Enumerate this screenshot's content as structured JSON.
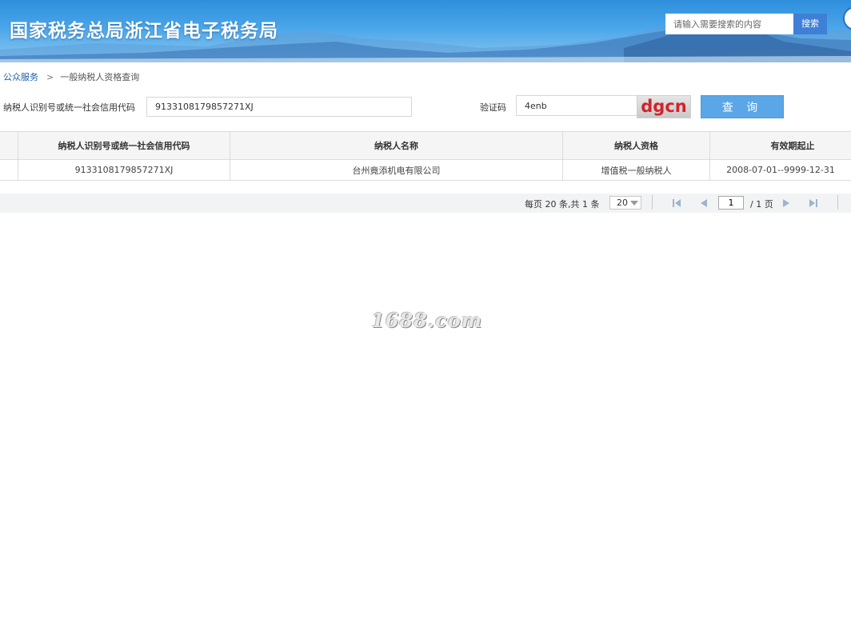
{
  "header": {
    "site_title": "国家税务总局浙江省电子税务局",
    "search_placeholder": "请输入需要搜索的内容",
    "search_button": "搜索"
  },
  "breadcrumb": {
    "root": "公众服务",
    "separator": ">",
    "current": "一般纳税人资格查询"
  },
  "form": {
    "taxpayer_id_label": "纳税人识别号或统一社会信用代码",
    "taxpayer_id_value": "9133108179857271XJ",
    "captcha_label": "验证码",
    "captcha_value": "4enb",
    "captcha_image_text": "dgcn",
    "query_button": "查 询"
  },
  "table": {
    "columns": [
      "纳税人识别号或统一社会信用代码",
      "纳税人名称",
      "纳税人资格",
      "有效期起止"
    ],
    "rows": [
      [
        "9133108179857271XJ",
        "台州竟添机电有限公司",
        "增值税一般纳税人",
        "2008-07-01--9999-12-31"
      ]
    ]
  },
  "pager": {
    "summary": "每页 20 条,共 1 条",
    "page_size": "20",
    "current_page": "1",
    "total": "/ 1 页"
  },
  "watermark": "1688.com",
  "colors": {
    "banner": "#3a95de",
    "search_button": "#3f7fd6",
    "query_button": "#5aa6e6",
    "link": "#1a5fa8",
    "captcha_text": "#d2232a"
  }
}
